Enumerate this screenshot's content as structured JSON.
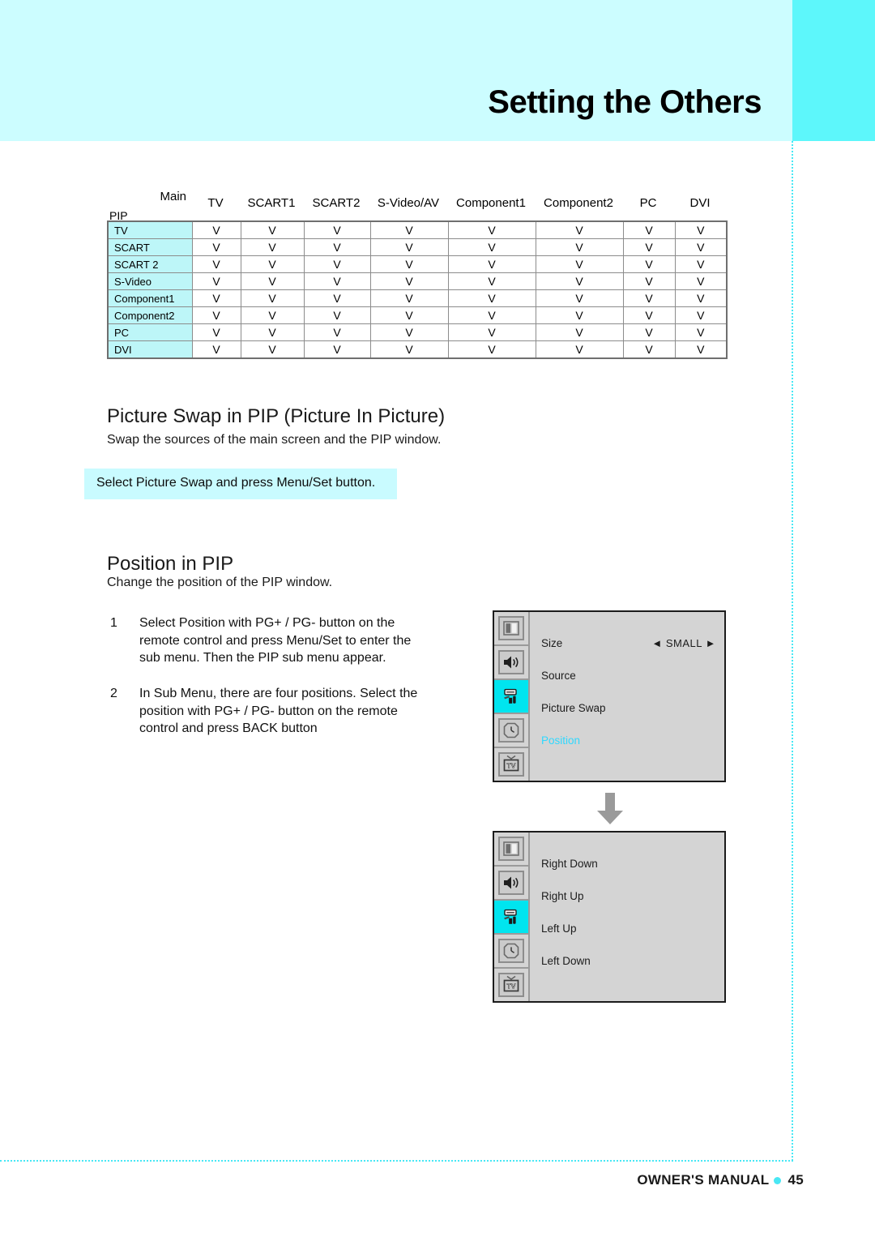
{
  "page": {
    "title": "Setting the Others",
    "footer_text": "OWNER'S MANUAL",
    "page_number": "45",
    "accent_color": "#5df7fb",
    "header_band_color": "#ccfdff",
    "note_band_color": "#c9fbff",
    "table_label_color": "#bdf6f8",
    "osd_highlight_color": "#00e5ef",
    "osd_selected_text_color": "#2fd8ff"
  },
  "matrix": {
    "corner_row_label": "PIP",
    "corner_col_label": "Main",
    "columns": [
      "TV",
      "SCART1",
      "SCART2",
      "S-Video/AV",
      "Component1",
      "Component2",
      "PC",
      "DVI"
    ],
    "rows": [
      {
        "label": "TV",
        "cells": [
          "V",
          "V",
          "V",
          "V",
          "V",
          "V",
          "V",
          "V"
        ]
      },
      {
        "label": "SCART",
        "cells": [
          "V",
          "V",
          "V",
          "V",
          "V",
          "V",
          "V",
          "V"
        ]
      },
      {
        "label": "SCART 2",
        "cells": [
          "V",
          "V",
          "V",
          "V",
          "V",
          "V",
          "V",
          "V"
        ]
      },
      {
        "label": "S-Video",
        "cells": [
          "V",
          "V",
          "V",
          "V",
          "V",
          "V",
          "V",
          "V"
        ]
      },
      {
        "label": "Component1",
        "cells": [
          "V",
          "V",
          "V",
          "V",
          "V",
          "V",
          "V",
          "V"
        ]
      },
      {
        "label": "Component2",
        "cells": [
          "V",
          "V",
          "V",
          "V",
          "V",
          "V",
          "V",
          "V"
        ]
      },
      {
        "label": "PC",
        "cells": [
          "V",
          "V",
          "V",
          "V",
          "V",
          "V",
          "V",
          "V"
        ]
      },
      {
        "label": "DVI",
        "cells": [
          "V",
          "V",
          "V",
          "V",
          "V",
          "V",
          "V",
          "V"
        ]
      }
    ]
  },
  "picture_swap": {
    "heading": "Picture Swap in PIP (Picture In Picture)",
    "description": "Swap the sources of the main screen and the PIP window.",
    "note": "Select Picture Swap and press Menu/Set button."
  },
  "position": {
    "heading": "Position in PIP",
    "description": "Change the position of the PIP window.",
    "steps": [
      {
        "number": "1",
        "text": "Select Position with PG+ / PG- button on the remote control and press Menu/Set to enter the sub menu. Then the PIP sub menu appear."
      },
      {
        "number": "2",
        "text": "In Sub Menu, there are four positions. Select the position with PG+ / PG- button on the remote control and press BACK button"
      }
    ]
  },
  "osd_main": {
    "icons": [
      "picture-icon",
      "sound-icon",
      "setup-icon",
      "time-icon",
      "tv-icon"
    ],
    "active_icon_index": 2,
    "rows": [
      {
        "label": "Size",
        "value": "◄ SMALL ►",
        "selected": false
      },
      {
        "label": "Source",
        "value": "",
        "selected": false
      },
      {
        "label": "Picture Swap",
        "value": "",
        "selected": false
      },
      {
        "label": "Position",
        "value": "",
        "selected": true
      }
    ]
  },
  "osd_sub": {
    "icons": [
      "picture-icon",
      "sound-icon",
      "setup-icon",
      "time-icon",
      "tv-icon"
    ],
    "active_icon_index": 2,
    "rows": [
      {
        "label": "Right Down",
        "value": "",
        "selected": false
      },
      {
        "label": "Right Up",
        "value": "",
        "selected": false
      },
      {
        "label": "Left Up",
        "value": "",
        "selected": false
      },
      {
        "label": "Left Down",
        "value": "",
        "selected": false
      }
    ]
  }
}
